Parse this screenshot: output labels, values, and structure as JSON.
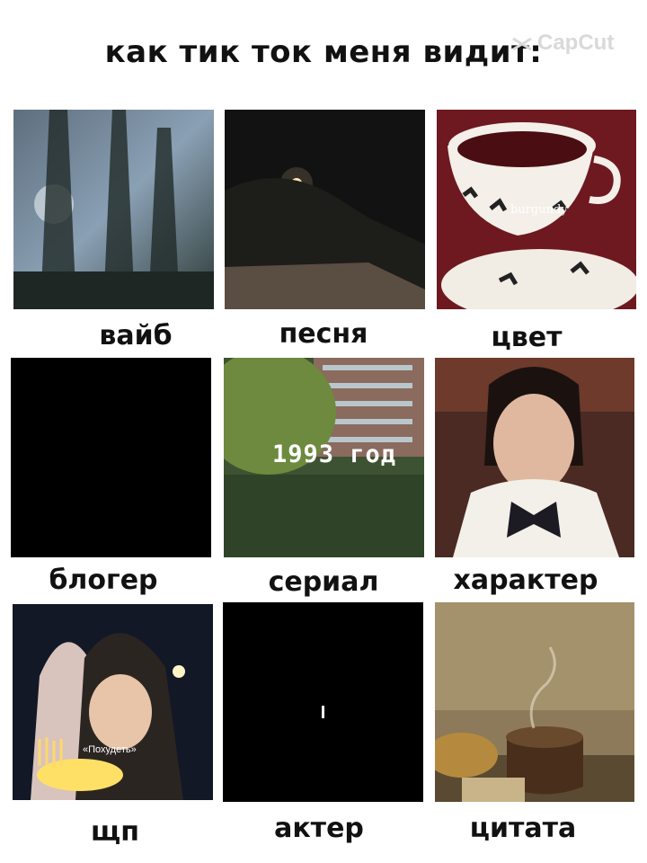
{
  "title": "как тик ток меня видит:",
  "watermark": "CapCut",
  "tiles": [
    {
      "label": "вайб",
      "overlay": ""
    },
    {
      "label": "песня",
      "overlay": ""
    },
    {
      "label": "цвет",
      "overlay": "burgundy"
    },
    {
      "label": "блогер",
      "overlay": ""
    },
    {
      "label": "сериал",
      "overlay": "1993 год"
    },
    {
      "label": "характер",
      "overlay": ""
    },
    {
      "label": "щп",
      "overlay": "«Похудеть»"
    },
    {
      "label": "актер",
      "overlay": ""
    },
    {
      "label": "цитата",
      "overlay": ""
    }
  ]
}
